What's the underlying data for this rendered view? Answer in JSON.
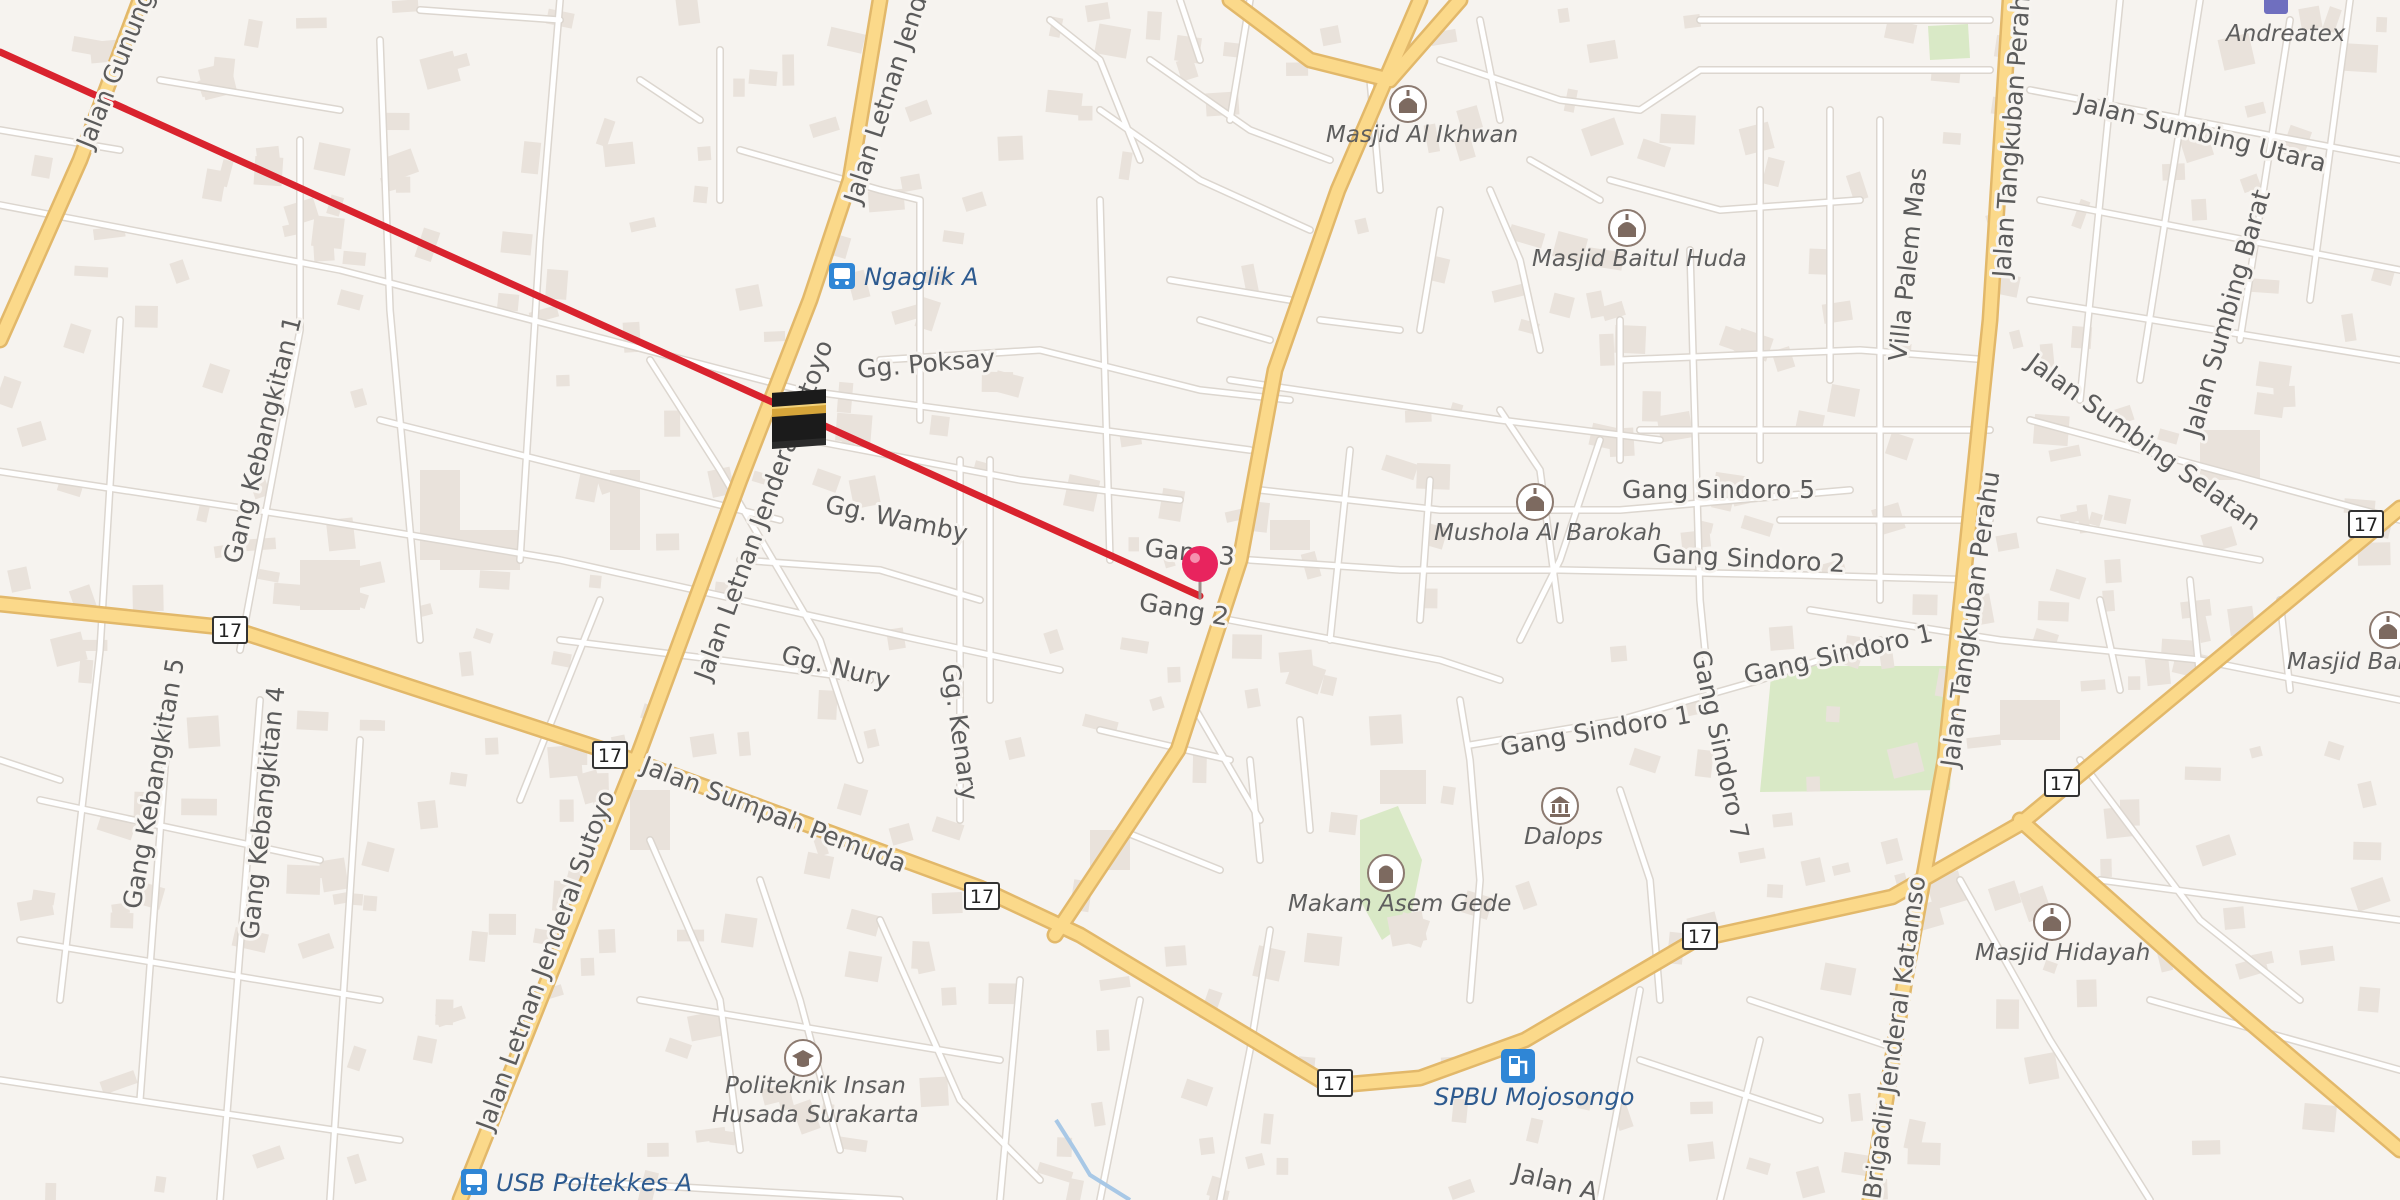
{
  "map": {
    "streets": {
      "s1": "Jalan Gunung",
      "s2": "Jalan Letnan Jendera",
      "s3": "Jalan Letnan Jenderal Sutoyo",
      "s4": "Jalan Letnan Jenderal Sutoyo",
      "s5": "Jalan Sumpah Pemuda",
      "s6": "Gg. Poksay",
      "s7": "Gg. Wamby",
      "s8": "Gg. Nury",
      "s9": "Gg. Kenary",
      "s10": "Gang 3",
      "s11": "Gang 2",
      "s12": "Gang Kebangkitan 1",
      "s13": "Gang Kebangkitan 4",
      "s14": "Gang Kebangkitan 5",
      "s15": "Gang Sindoro 5",
      "s16": "Gang Sindoro 2",
      "s17": "Gang Sindoro 1",
      "s18": "Gang Sindoro 1",
      "s19": "Gang Sindoro 7",
      "s20": "Villa Palem Mas",
      "s21": "Jalan Tangkuban Perahu",
      "s22": "Jalan Tangkuban Perahu",
      "s23": "Jalan Sumbing Utara",
      "s24": "Jalan Sumbing Barat",
      "s25": "Jalan Sumbing Selatan",
      "s26": "Brigadir Jenderal Katamso",
      "s27": "Jalan A"
    },
    "pois": {
      "ngaglik": "Ngaglik A",
      "masjid_ikhwan": "Masjid Al Ikhwan",
      "masjid_baitul_huda": "Masjid Baitul Huda",
      "mushola": "Mushola Al Barokah",
      "dalops": "Dalops",
      "makam": "Makam Asem Gede",
      "masjid_hidayah": "Masjid Hidayah",
      "masjid_bait": "Masjid Bait",
      "spbu": "SPBU Mojosongo",
      "politeknik_1": "Politeknik Insan",
      "politeknik_2": "Husada Surakarta",
      "usb": "USB Poltekkes A",
      "andreatex": "Andreatex"
    },
    "route_shields": {
      "r1": "17",
      "r2": "17",
      "r3": "17",
      "r4": "17",
      "r5": "17",
      "r6": "17",
      "r7": "17"
    },
    "colors": {
      "background": "#f6f3ef",
      "major_road": "#fbd98a",
      "major_road_casing": "#e2b86a",
      "minor_road": "#ffffff",
      "minor_road_casing": "#dcd6cf",
      "building": "#e9e2db",
      "park": "#d9e9c6",
      "qibla_line": "#d9232e",
      "pin": "#e8245e",
      "water": "#a8c8e6"
    },
    "icons": {
      "kaaba": "kaaba-icon",
      "pin": "location-pin-icon",
      "bus": "bus-stop-icon",
      "mosque": "mosque-icon",
      "fuel": "fuel-station-icon",
      "school": "graduation-cap-icon",
      "museum": "museum-icon",
      "cemetery": "cemetery-icon"
    }
  }
}
